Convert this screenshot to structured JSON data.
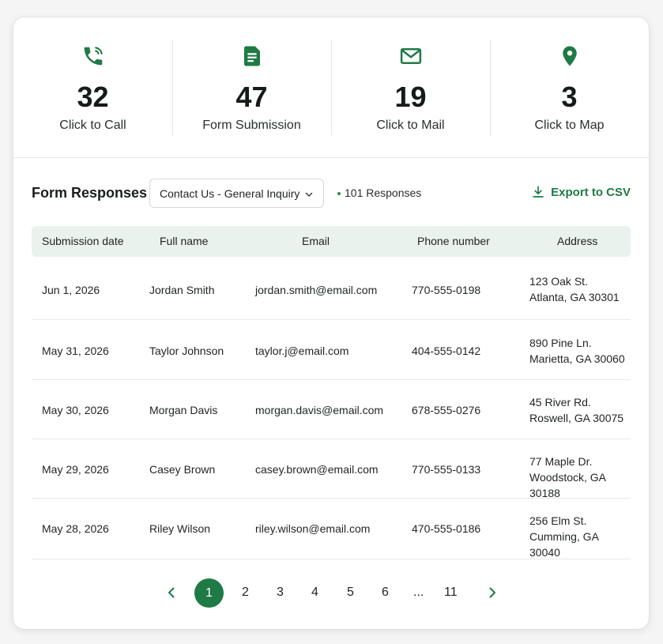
{
  "stats": [
    {
      "icon": "phone-icon",
      "value": "32",
      "label": "Click to Call"
    },
    {
      "icon": "document-icon",
      "value": "47",
      "label": "Form Submission"
    },
    {
      "icon": "mail-icon",
      "value": "19",
      "label": "Click to Mail"
    },
    {
      "icon": "map-pin-icon",
      "value": "3",
      "label": "Click to Map"
    }
  ],
  "toolbar": {
    "title": "Form Responses",
    "form_select": "Contact Us - General Inquiry",
    "responses": "101 Responses",
    "export_label": "Export to CSV"
  },
  "table": {
    "headers": [
      "Submission date",
      "Full name",
      "Email",
      "Phone number",
      "Address"
    ],
    "rows": [
      {
        "date": "Jun 1, 2026",
        "name": "Jordan Smith",
        "email": "jordan.smith@email.com",
        "phone": "770-555-0198",
        "addr1": "123 Oak St.",
        "addr2": "Atlanta, GA 30301"
      },
      {
        "date": "May 31, 2026",
        "name": "Taylor Johnson",
        "email": "taylor.j@email.com",
        "phone": "404-555-0142",
        "addr1": "890 Pine Ln.",
        "addr2": "Marietta, GA 30060"
      },
      {
        "date": "May 30, 2026",
        "name": "Morgan Davis",
        "email": "morgan.davis@email.com",
        "phone": "678-555-0276",
        "addr1": "45 River Rd.",
        "addr2": "Roswell, GA 30075"
      },
      {
        "date": "May 29, 2026",
        "name": "Casey Brown",
        "email": "casey.brown@email.com",
        "phone": "770-555-0133",
        "addr1": "77 Maple Dr.",
        "addr2": "Woodstock, GA 30188"
      },
      {
        "date": "May 28, 2026",
        "name": "Riley Wilson",
        "email": "riley.wilson@email.com",
        "phone": "470-555-0186",
        "addr1": "256 Elm St.",
        "addr2": "Cumming, GA 30040"
      }
    ]
  },
  "pagination": {
    "pages": [
      "1",
      "2",
      "3",
      "4",
      "5",
      "6",
      "...",
      "11"
    ],
    "current": "1"
  },
  "colors": {
    "accent": "#1f7a45",
    "header_bg": "#e9f2ec"
  }
}
